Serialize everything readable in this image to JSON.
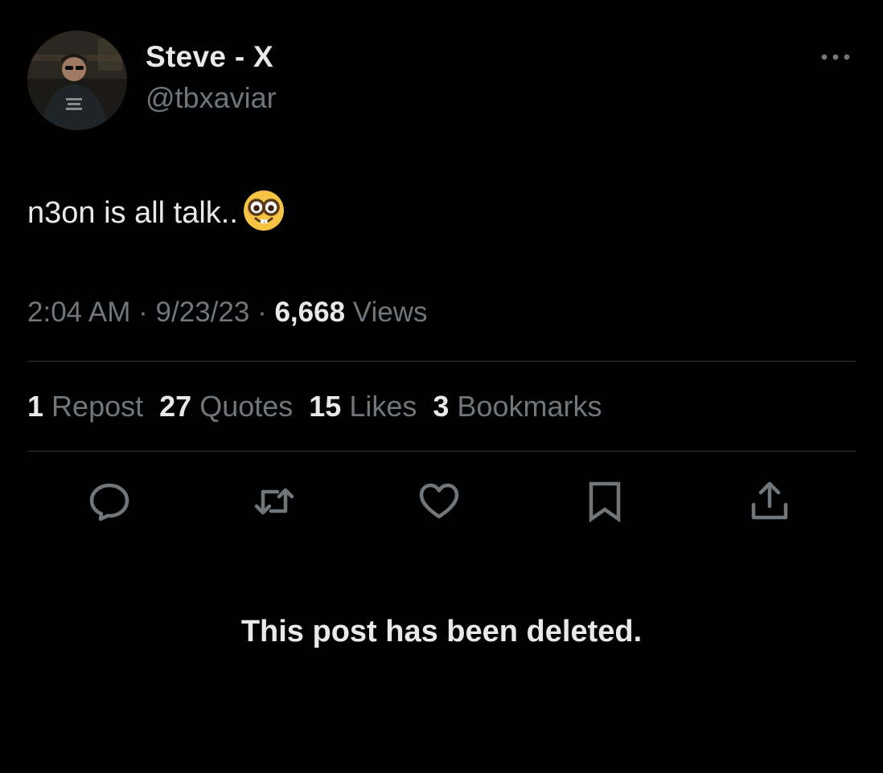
{
  "author": {
    "display_name": "Steve - X",
    "handle": "@tbxaviar"
  },
  "post": {
    "text": "n3on is all talk..",
    "emoji": "nerd-face",
    "time": "2:04 AM",
    "date": "9/23/23",
    "views_count": "6,668",
    "views_label": "Views"
  },
  "stats": [
    {
      "count": "1",
      "label": "Repost"
    },
    {
      "count": "27",
      "label": "Quotes"
    },
    {
      "count": "15",
      "label": "Likes"
    },
    {
      "count": "3",
      "label": "Bookmarks"
    }
  ],
  "actions": [
    "reply-icon",
    "repost-icon",
    "like-icon",
    "bookmark-icon",
    "share-icon"
  ],
  "notice": "This post has been deleted.",
  "colors": {
    "background": "#000000",
    "primary_text": "#e7e9ea",
    "secondary_text": "#71767b",
    "divider": "#2f3336"
  }
}
